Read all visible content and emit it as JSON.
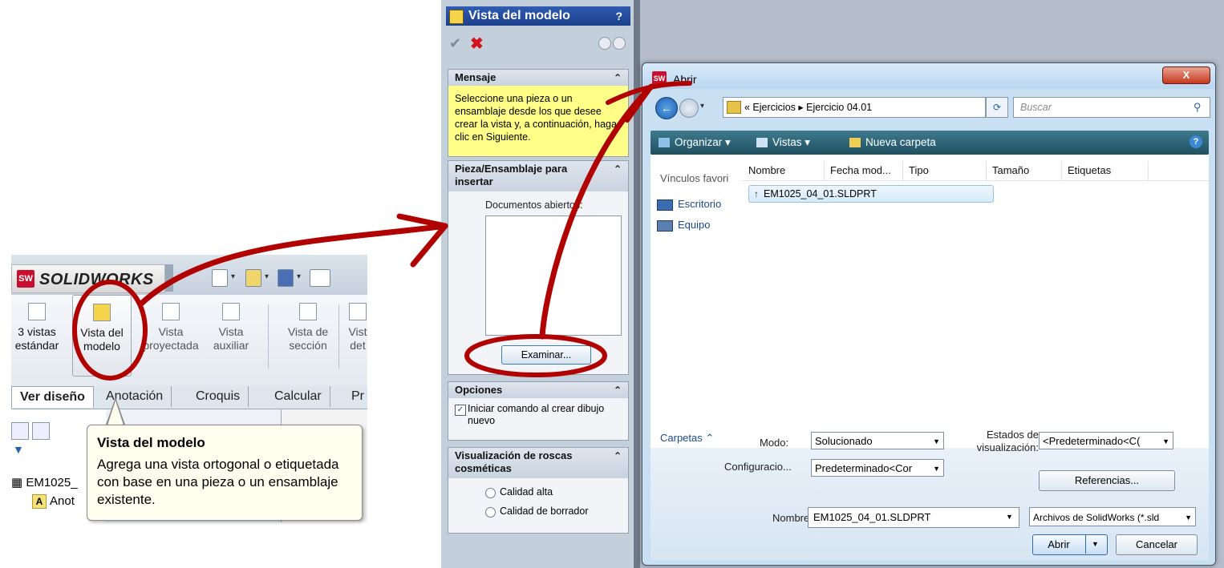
{
  "solidworks": {
    "logo_mark": "SW",
    "logo_text": "SOLIDWORKS",
    "commands": [
      {
        "label": "3 vistas\nestándar"
      },
      {
        "label": "Vista del\nmodelo"
      },
      {
        "label": "Vista\nproyectada"
      },
      {
        "label": "Vista\nauxiliar"
      },
      {
        "label": "Vista de\nsección"
      },
      {
        "label": "Vist\ndet"
      }
    ],
    "tabs": [
      "Ver diseño",
      "Anotación",
      "Croquis",
      "Calcular",
      "Pr"
    ],
    "tree": {
      "item1": "EM1025_",
      "item2": "Anot"
    },
    "tooltip": {
      "title": "Vista del modelo",
      "description": "Agrega una vista ortogonal o etiquetada con base en una pieza o un ensamblaje existente."
    }
  },
  "property_manager": {
    "title": "Vista del modelo",
    "help": "?",
    "mensaje": {
      "header": "Mensaje",
      "text": "Seleccione una pieza o un ensamblaje desde los que desee crear la vista y, a continuación, haga clic en Siguiente."
    },
    "pieza": {
      "header": "Pieza/Ensamblaje para insertar",
      "docs_label": "Documentos abiertos:",
      "browse_button": "Examinar..."
    },
    "opciones": {
      "header": "Opciones",
      "checkbox_label": "Iniciar comando al crear dibujo nuevo",
      "checked": true
    },
    "roscas": {
      "header": "Visualización de roscas cosméticas",
      "option1": "Calidad alta",
      "option2": "Calidad de borrador"
    }
  },
  "dialog": {
    "title": "Abrir",
    "close": "X",
    "breadcrumb": "« Ejercicios ▸ Ejercicio 04.01",
    "search_placeholder": "Buscar",
    "toolbar": {
      "organize": "Organizar ▾",
      "views": "Vistas ▾",
      "new_folder": "Nueva carpeta"
    },
    "nav": {
      "favorites": "Vínculos favori",
      "desktop": "Escritorio",
      "computer": "Equipo",
      "folders": "Carpetas ⌃"
    },
    "columns": [
      "Nombre",
      "Fecha mod...",
      "Tipo",
      "Tamaño",
      "Etiquetas"
    ],
    "files": [
      {
        "name": "EM1025_04_01.SLDPRT"
      }
    ],
    "mode_label": "Modo:",
    "mode_value": "Solucionado",
    "config_label": "Configuracio...",
    "config_value": "Predeterminado<Cor",
    "display_states_label": "Estados de visualización:",
    "display_states_value": "<Predeterminado<C(",
    "references_button": "Referencias...",
    "filename_label": "Nombre:",
    "filename_value": "EM1025_04_01.SLDPRT",
    "filetype_value": "Archivos de SolidWorks (*.sld",
    "open_button": "Abrir",
    "cancel_button": "Cancelar"
  },
  "colors": {
    "annotation": "#b00000",
    "message_bg": "#ffff88",
    "dialog_toolbar": "#2a6072"
  }
}
